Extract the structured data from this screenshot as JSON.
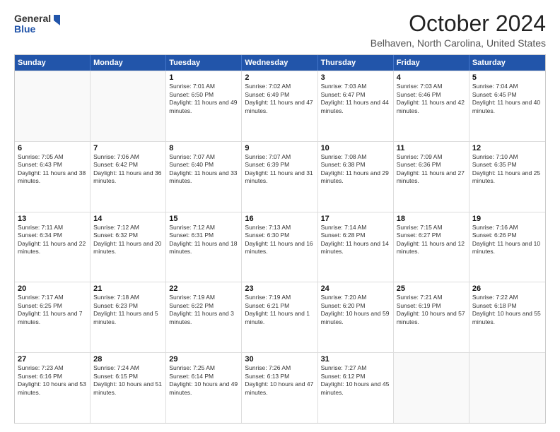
{
  "logo": {
    "line1": "General",
    "line2": "Blue",
    "icon_color": "#2255aa"
  },
  "title": "October 2024",
  "subtitle": "Belhaven, North Carolina, United States",
  "header": {
    "days": [
      "Sunday",
      "Monday",
      "Tuesday",
      "Wednesday",
      "Thursday",
      "Friday",
      "Saturday"
    ]
  },
  "weeks": [
    [
      {
        "day": "",
        "sunrise": "",
        "sunset": "",
        "daylight": "",
        "empty": true
      },
      {
        "day": "",
        "sunrise": "",
        "sunset": "",
        "daylight": "",
        "empty": true
      },
      {
        "day": "1",
        "sunrise": "Sunrise: 7:01 AM",
        "sunset": "Sunset: 6:50 PM",
        "daylight": "Daylight: 11 hours and 49 minutes."
      },
      {
        "day": "2",
        "sunrise": "Sunrise: 7:02 AM",
        "sunset": "Sunset: 6:49 PM",
        "daylight": "Daylight: 11 hours and 47 minutes."
      },
      {
        "day": "3",
        "sunrise": "Sunrise: 7:03 AM",
        "sunset": "Sunset: 6:47 PM",
        "daylight": "Daylight: 11 hours and 44 minutes."
      },
      {
        "day": "4",
        "sunrise": "Sunrise: 7:03 AM",
        "sunset": "Sunset: 6:46 PM",
        "daylight": "Daylight: 11 hours and 42 minutes."
      },
      {
        "day": "5",
        "sunrise": "Sunrise: 7:04 AM",
        "sunset": "Sunset: 6:45 PM",
        "daylight": "Daylight: 11 hours and 40 minutes."
      }
    ],
    [
      {
        "day": "6",
        "sunrise": "Sunrise: 7:05 AM",
        "sunset": "Sunset: 6:43 PM",
        "daylight": "Daylight: 11 hours and 38 minutes."
      },
      {
        "day": "7",
        "sunrise": "Sunrise: 7:06 AM",
        "sunset": "Sunset: 6:42 PM",
        "daylight": "Daylight: 11 hours and 36 minutes."
      },
      {
        "day": "8",
        "sunrise": "Sunrise: 7:07 AM",
        "sunset": "Sunset: 6:40 PM",
        "daylight": "Daylight: 11 hours and 33 minutes."
      },
      {
        "day": "9",
        "sunrise": "Sunrise: 7:07 AM",
        "sunset": "Sunset: 6:39 PM",
        "daylight": "Daylight: 11 hours and 31 minutes."
      },
      {
        "day": "10",
        "sunrise": "Sunrise: 7:08 AM",
        "sunset": "Sunset: 6:38 PM",
        "daylight": "Daylight: 11 hours and 29 minutes."
      },
      {
        "day": "11",
        "sunrise": "Sunrise: 7:09 AM",
        "sunset": "Sunset: 6:36 PM",
        "daylight": "Daylight: 11 hours and 27 minutes."
      },
      {
        "day": "12",
        "sunrise": "Sunrise: 7:10 AM",
        "sunset": "Sunset: 6:35 PM",
        "daylight": "Daylight: 11 hours and 25 minutes."
      }
    ],
    [
      {
        "day": "13",
        "sunrise": "Sunrise: 7:11 AM",
        "sunset": "Sunset: 6:34 PM",
        "daylight": "Daylight: 11 hours and 22 minutes."
      },
      {
        "day": "14",
        "sunrise": "Sunrise: 7:12 AM",
        "sunset": "Sunset: 6:32 PM",
        "daylight": "Daylight: 11 hours and 20 minutes."
      },
      {
        "day": "15",
        "sunrise": "Sunrise: 7:12 AM",
        "sunset": "Sunset: 6:31 PM",
        "daylight": "Daylight: 11 hours and 18 minutes."
      },
      {
        "day": "16",
        "sunrise": "Sunrise: 7:13 AM",
        "sunset": "Sunset: 6:30 PM",
        "daylight": "Daylight: 11 hours and 16 minutes."
      },
      {
        "day": "17",
        "sunrise": "Sunrise: 7:14 AM",
        "sunset": "Sunset: 6:28 PM",
        "daylight": "Daylight: 11 hours and 14 minutes."
      },
      {
        "day": "18",
        "sunrise": "Sunrise: 7:15 AM",
        "sunset": "Sunset: 6:27 PM",
        "daylight": "Daylight: 11 hours and 12 minutes."
      },
      {
        "day": "19",
        "sunrise": "Sunrise: 7:16 AM",
        "sunset": "Sunset: 6:26 PM",
        "daylight": "Daylight: 11 hours and 10 minutes."
      }
    ],
    [
      {
        "day": "20",
        "sunrise": "Sunrise: 7:17 AM",
        "sunset": "Sunset: 6:25 PM",
        "daylight": "Daylight: 11 hours and 7 minutes."
      },
      {
        "day": "21",
        "sunrise": "Sunrise: 7:18 AM",
        "sunset": "Sunset: 6:23 PM",
        "daylight": "Daylight: 11 hours and 5 minutes."
      },
      {
        "day": "22",
        "sunrise": "Sunrise: 7:19 AM",
        "sunset": "Sunset: 6:22 PM",
        "daylight": "Daylight: 11 hours and 3 minutes."
      },
      {
        "day": "23",
        "sunrise": "Sunrise: 7:19 AM",
        "sunset": "Sunset: 6:21 PM",
        "daylight": "Daylight: 11 hours and 1 minute."
      },
      {
        "day": "24",
        "sunrise": "Sunrise: 7:20 AM",
        "sunset": "Sunset: 6:20 PM",
        "daylight": "Daylight: 10 hours and 59 minutes."
      },
      {
        "day": "25",
        "sunrise": "Sunrise: 7:21 AM",
        "sunset": "Sunset: 6:19 PM",
        "daylight": "Daylight: 10 hours and 57 minutes."
      },
      {
        "day": "26",
        "sunrise": "Sunrise: 7:22 AM",
        "sunset": "Sunset: 6:18 PM",
        "daylight": "Daylight: 10 hours and 55 minutes."
      }
    ],
    [
      {
        "day": "27",
        "sunrise": "Sunrise: 7:23 AM",
        "sunset": "Sunset: 6:16 PM",
        "daylight": "Daylight: 10 hours and 53 minutes."
      },
      {
        "day": "28",
        "sunrise": "Sunrise: 7:24 AM",
        "sunset": "Sunset: 6:15 PM",
        "daylight": "Daylight: 10 hours and 51 minutes."
      },
      {
        "day": "29",
        "sunrise": "Sunrise: 7:25 AM",
        "sunset": "Sunset: 6:14 PM",
        "daylight": "Daylight: 10 hours and 49 minutes."
      },
      {
        "day": "30",
        "sunrise": "Sunrise: 7:26 AM",
        "sunset": "Sunset: 6:13 PM",
        "daylight": "Daylight: 10 hours and 47 minutes."
      },
      {
        "day": "31",
        "sunrise": "Sunrise: 7:27 AM",
        "sunset": "Sunset: 6:12 PM",
        "daylight": "Daylight: 10 hours and 45 minutes."
      },
      {
        "day": "",
        "sunrise": "",
        "sunset": "",
        "daylight": "",
        "empty": true
      },
      {
        "day": "",
        "sunrise": "",
        "sunset": "",
        "daylight": "",
        "empty": true
      }
    ]
  ]
}
